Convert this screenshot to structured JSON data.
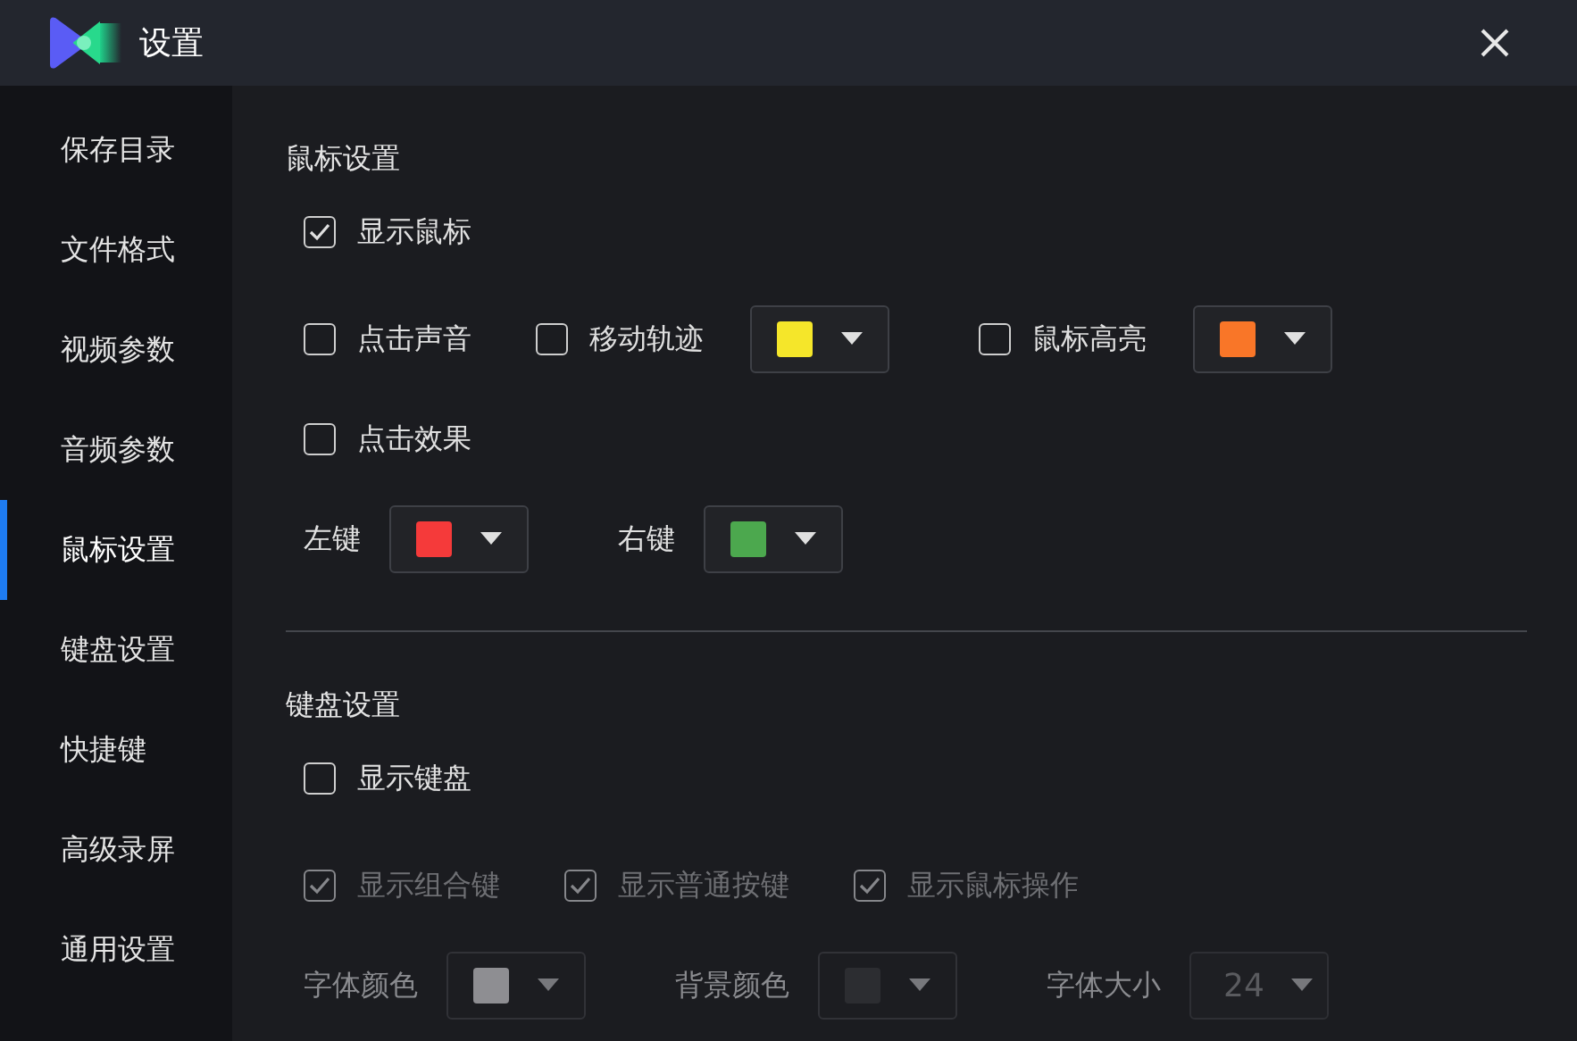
{
  "window": {
    "title": "设置"
  },
  "sidebar": {
    "items": [
      {
        "label": "保存目录",
        "selected": false
      },
      {
        "label": "文件格式",
        "selected": false
      },
      {
        "label": "视频参数",
        "selected": false
      },
      {
        "label": "音频参数",
        "selected": false
      },
      {
        "label": "鼠标设置",
        "selected": true
      },
      {
        "label": "键盘设置",
        "selected": false
      },
      {
        "label": "快捷键",
        "selected": false
      },
      {
        "label": "高级录屏",
        "selected": false
      },
      {
        "label": "通用设置",
        "selected": false
      }
    ]
  },
  "sections": [
    {
      "title": "鼠标设置",
      "rows": [
        [
          {
            "kind": "checkbox",
            "label": "显示鼠标",
            "checked": true,
            "disabled": false
          }
        ],
        [
          {
            "kind": "checkbox",
            "label": "点击声音",
            "checked": false,
            "disabled": false
          },
          {
            "kind": "checkbox",
            "label": "移动轨迹",
            "checked": false,
            "disabled": false,
            "color": "#f5e62a"
          },
          {
            "kind": "checkbox",
            "label": "鼠标高亮",
            "checked": false,
            "disabled": false,
            "color": "#f97628"
          }
        ],
        [
          {
            "kind": "checkbox",
            "label": "点击效果",
            "checked": false,
            "disabled": false
          }
        ],
        [
          {
            "kind": "color",
            "label": "左键",
            "color": "#f53a3a",
            "disabled": false
          },
          {
            "kind": "color",
            "label": "右键",
            "color": "#4ca84e",
            "disabled": false
          }
        ]
      ]
    },
    {
      "title": "键盘设置",
      "rows": [
        [
          {
            "kind": "checkbox",
            "label": "显示键盘",
            "checked": false,
            "disabled": false
          }
        ],
        [
          {
            "kind": "checkbox",
            "label": "显示组合键",
            "checked": true,
            "disabled": true
          },
          {
            "kind": "checkbox",
            "label": "显示普通按键",
            "checked": true,
            "disabled": true
          },
          {
            "kind": "checkbox",
            "label": "显示鼠标操作",
            "checked": true,
            "disabled": true
          }
        ],
        [
          {
            "kind": "color",
            "label": "字体颜色",
            "color": "#8e8e92",
            "disabled": true
          },
          {
            "kind": "color",
            "label": "背景颜色",
            "color": "#2c2d31",
            "disabled": true
          },
          {
            "kind": "select",
            "label": "字体大小",
            "value": "24",
            "disabled": true
          }
        ]
      ]
    }
  ]
}
